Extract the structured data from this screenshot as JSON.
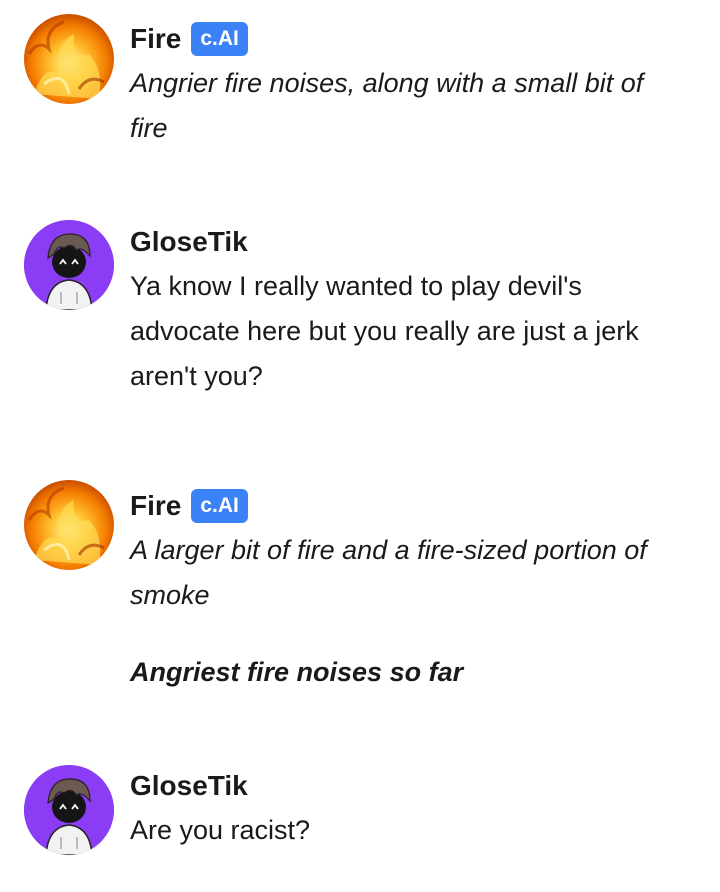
{
  "messages": [
    {
      "author": "Fire",
      "badge": "c.AI",
      "avatar_icon": "fire-avatar-icon",
      "paragraphs": [
        {
          "text": "Angrier fire noises, along with a small bit of fire",
          "style": "italic"
        }
      ]
    },
    {
      "author": "GloseTik",
      "avatar_icon": "cartoon-character-avatar-icon",
      "paragraphs": [
        {
          "text": "Ya know I really wanted to play devil's advocate here but you really are just a jerk aren't you?",
          "style": "normal"
        }
      ]
    },
    {
      "author": "Fire",
      "badge": "c.AI",
      "avatar_icon": "fire-avatar-icon",
      "paragraphs": [
        {
          "text": "A larger bit of fire and a fire-sized portion of smoke",
          "style": "italic"
        },
        {
          "text": "Angriest fire noises so far",
          "style": "bold-italic"
        }
      ]
    },
    {
      "author": "GloseTik",
      "avatar_icon": "cartoon-character-avatar-icon",
      "paragraphs": [
        {
          "text": "Are you racist?",
          "style": "normal"
        }
      ]
    }
  ],
  "colors": {
    "badge": "#3b82f6",
    "text": "#1a1a1a",
    "fire_orange": "#f7941d",
    "purple": "#7b2ff2"
  }
}
